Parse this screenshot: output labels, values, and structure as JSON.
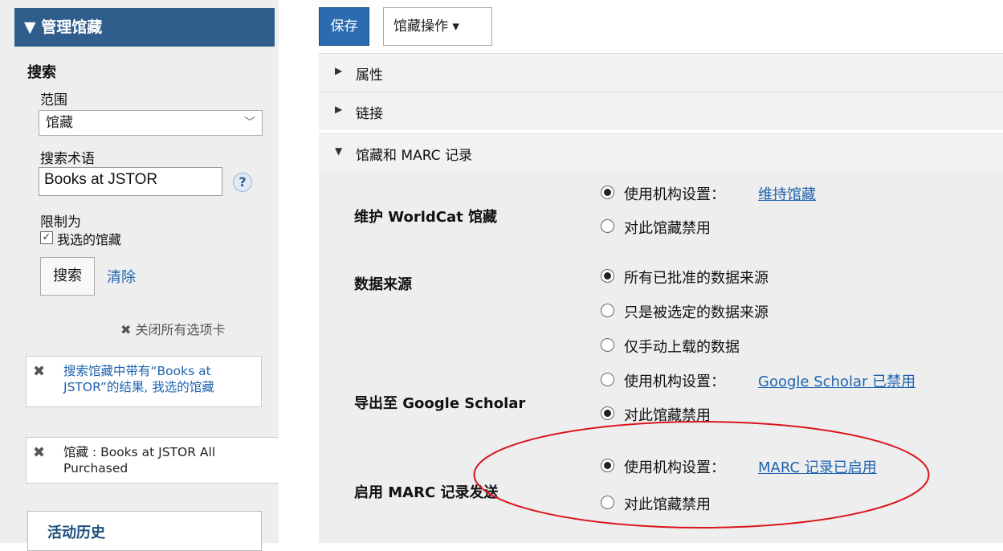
{
  "sidebar": {
    "header": "▼ 管理馆藏",
    "search_heading": "搜索",
    "scope_label": "范围",
    "scope_value": "馆藏",
    "term_label": "搜索术语",
    "term_value": "Books at JSTOR",
    "help": "?",
    "limit_label": "限制为",
    "limit_checkbox_label": "我选的馆藏",
    "limit_checked": true,
    "search_button": "搜索",
    "clear_link": "清除",
    "close_all": "关闭所有选项卡",
    "cards": [
      {
        "line1": "搜索馆藏中带有“Books at",
        "line2": "JSTOR”的结果, 我选的馆藏"
      },
      {
        "line1": "馆藏 : Books at JSTOR All",
        "line2": "Purchased"
      }
    ],
    "history": "活动历史"
  },
  "toolbar": {
    "save": "保存",
    "actions": "馆藏操作 ▾"
  },
  "sections": [
    {
      "label": "属性",
      "expanded": false
    },
    {
      "label": "链接",
      "expanded": false
    },
    {
      "label": "馆藏和 MARC 记录",
      "expanded": true
    }
  ],
  "fields": {
    "maintain": {
      "label": "维护 WorldCat 馆藏",
      "opt1": "使用机构设置：",
      "opt1_link": "维持馆藏",
      "opt2": "对此馆藏禁用"
    },
    "source": {
      "label": "数据来源",
      "opt1": "所有已批准的数据来源",
      "opt2": "只是被选定的数据来源",
      "opt3": "仅手动上载的数据"
    },
    "scholar": {
      "label": "导出至 Google Scholar",
      "opt1": "使用机构设置：",
      "opt1_link": "Google Scholar 已禁用",
      "opt2": "对此馆藏禁用"
    },
    "marc": {
      "label": "启用 MARC 记录发送",
      "opt1": "使用机构设置：",
      "opt1_link": "MARC 记录已启用",
      "opt2": "对此馆藏禁用"
    }
  },
  "colors": {
    "accent": "#2f5d8c",
    "link": "#1f63b0",
    "annotation": "#d9161b"
  }
}
